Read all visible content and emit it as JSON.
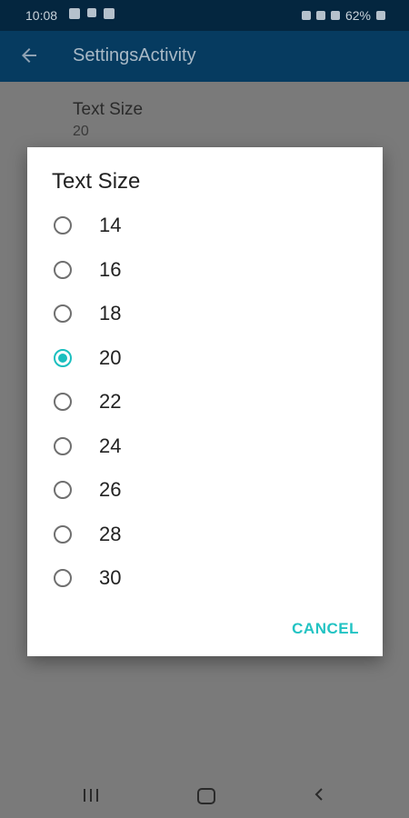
{
  "status": {
    "time": "10:08",
    "battery": "62%"
  },
  "appbar": {
    "title": "SettingsActivity"
  },
  "preference": {
    "title": "Text Size",
    "summary": "20"
  },
  "dialog": {
    "title": "Text Size",
    "options": [
      "14",
      "16",
      "18",
      "20",
      "22",
      "24",
      "26",
      "28",
      "30"
    ],
    "selected": "20",
    "cancel_label": "CANCEL"
  },
  "colors": {
    "accent": "#1bbfbf",
    "appbar": "#063b60",
    "statusbar": "#04263f"
  }
}
